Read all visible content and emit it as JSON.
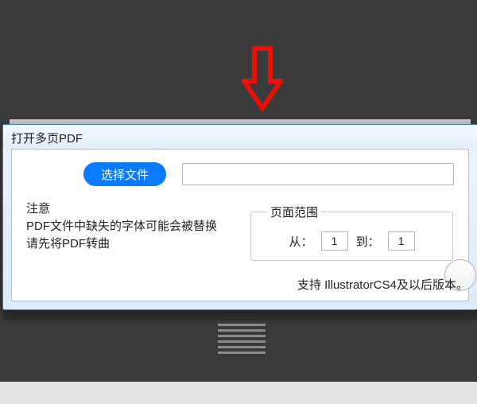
{
  "dialog": {
    "title": "打开多页PDF",
    "selectFileButton": "选择文件",
    "filePath": "",
    "notice": {
      "line1": "注意",
      "line2": "PDF文件中缺失的字体可能会被替换",
      "line3": "请先将PDF转曲"
    },
    "pageRange": {
      "legend": "页面范围",
      "fromLabel": "从：",
      "fromValue": "1",
      "toLabel": "到：",
      "toValue": "1"
    },
    "supportText": "支持 IllustratorCS4及以后版本。"
  }
}
